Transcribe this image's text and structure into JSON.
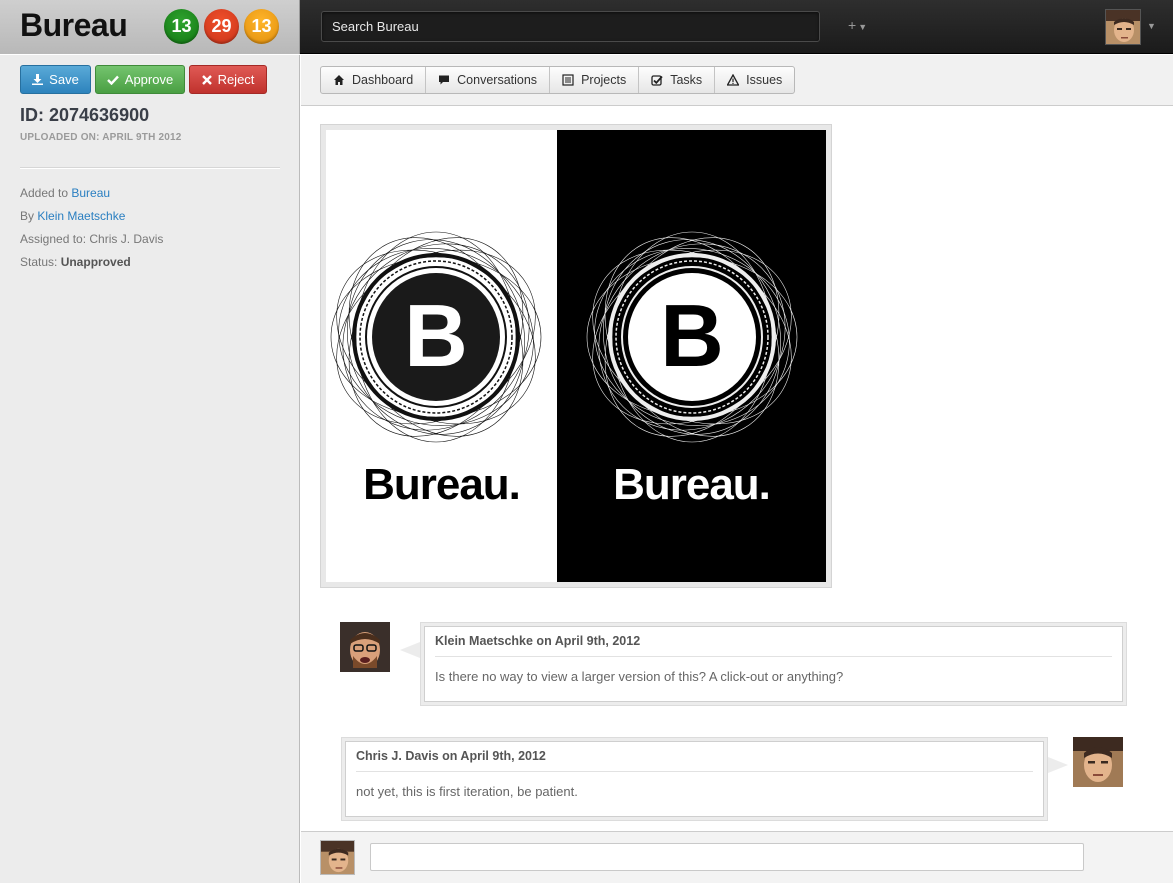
{
  "app": {
    "brand": "Bureau"
  },
  "badges": [
    {
      "value": "13",
      "color": "#1a8a1a"
    },
    {
      "value": "29",
      "color": "#d93d1f"
    },
    {
      "value": "13",
      "color": "#f39c12"
    }
  ],
  "search": {
    "placeholder": "Search Bureau"
  },
  "topbar": {
    "plus_label": "+",
    "plus_icon": "chevron-down-icon"
  },
  "actions": {
    "save_label": "Save",
    "approve_label": "Approve",
    "reject_label": "Reject"
  },
  "item": {
    "id_label": "ID: 2074636900",
    "uploaded_label": "UPLOADED ON: APRIL 9TH 2012",
    "added_prefix": "Added to ",
    "added_link": "Bureau",
    "by_prefix": "By ",
    "by_link": "Klein Maetschke",
    "assigned": "Assigned to: Chris J. Davis",
    "status_prefix": "Status: ",
    "status_value": "Unapproved"
  },
  "tabs": [
    {
      "label": "Dashboard",
      "icon": "home-icon"
    },
    {
      "label": "Conversations",
      "icon": "speech-bubble-icon"
    },
    {
      "label": "Projects",
      "icon": "list-icon"
    },
    {
      "label": "Tasks",
      "icon": "checkbox-icon"
    },
    {
      "label": "Issues",
      "icon": "warning-icon"
    }
  ],
  "artwork": {
    "wordmark": "Bureau.",
    "letter": "B"
  },
  "comments": [
    {
      "header": "Klein Maetschke on April 9th, 2012",
      "body": "Is there no way to view a larger version of this? A click-out or anything?"
    },
    {
      "header": "Chris J. Davis on April 9th, 2012",
      "body": "not yet, this is first iteration, be patient."
    }
  ],
  "composer": {
    "placeholder": ""
  }
}
